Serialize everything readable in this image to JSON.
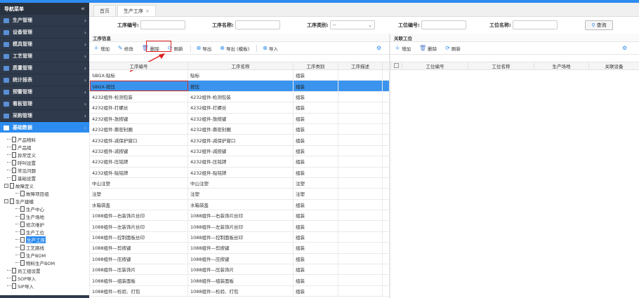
{
  "sidebar": {
    "title": "导航菜单",
    "collapse_icon": "«",
    "menu": [
      {
        "label": "生产管理",
        "icon": "gear-icon"
      },
      {
        "label": "设备管理",
        "icon": "grid-icon"
      },
      {
        "label": "模具管理",
        "icon": "table-icon"
      },
      {
        "label": "工艺管理",
        "icon": "heart-icon"
      },
      {
        "label": "质量管理",
        "icon": "circle-icon"
      },
      {
        "label": "统计报表",
        "icon": "chart-icon"
      },
      {
        "label": "预警管理",
        "icon": "chart-icon"
      },
      {
        "label": "看板管理",
        "icon": "screen-icon"
      },
      {
        "label": "采购管理",
        "icon": "cart-icon"
      },
      {
        "label": "基础数据",
        "icon": "gear-icon"
      }
    ],
    "tree": [
      {
        "label": "产品物料",
        "level": 1
      },
      {
        "label": "产品组",
        "level": 1
      },
      {
        "label": "异常定义",
        "level": 1
      },
      {
        "label": "呼叫设置",
        "level": 1
      },
      {
        "label": "常见问题",
        "level": 1
      },
      {
        "label": "基础设置",
        "level": 1
      },
      {
        "label": "故障定义",
        "level": 0,
        "toggle": "-"
      },
      {
        "label": "故障项目组",
        "level": 2
      },
      {
        "label": "生产建模",
        "level": 0,
        "toggle": "-"
      },
      {
        "label": "生产中心",
        "level": 2
      },
      {
        "label": "生产场地",
        "level": 2
      },
      {
        "label": "班次维护",
        "level": 2
      },
      {
        "label": "生产工位",
        "level": 2
      },
      {
        "label": "生产工序",
        "level": 2,
        "selected": true
      },
      {
        "label": "工艺路线",
        "level": 2
      },
      {
        "label": "生产BOM",
        "level": 2
      },
      {
        "label": "物料生产BOM",
        "level": 2
      },
      {
        "label": "员工组设置",
        "level": 1
      },
      {
        "label": "SOP导入",
        "level": 1
      },
      {
        "label": "SIP导入",
        "level": 1
      }
    ]
  },
  "tabs": [
    {
      "label": "首页"
    },
    {
      "label": "生产工序",
      "close": "×"
    }
  ],
  "search": {
    "process_code_label": "工序编号:",
    "process_name_label": "工序名称:",
    "process_type_label": "工序类别:",
    "process_type_value": "--",
    "station_code_label": "工位编号:",
    "station_name_label": "工位名称:",
    "query_label": "查询"
  },
  "left_panel": {
    "title": "工序信息",
    "toolbar": {
      "add": "增加",
      "edit": "修改",
      "delete": "删除",
      "refresh": "刷新",
      "export": "导出",
      "export_template": "导出 (模板)",
      "import": "导入"
    },
    "columns": [
      "工序编号",
      "工序名称",
      "工序类别",
      "工序描述"
    ],
    "rows": [
      [
        "SBGX-贴标",
        "贴标",
        "组装",
        ""
      ],
      [
        "SBGX-按压",
        "按压",
        "组装",
        ""
      ],
      [
        "4232组件-检测包装",
        "4232组件-检测包装",
        "组装",
        ""
      ],
      [
        "4232组件-打螺丝",
        "4232组件-打螺丝",
        "组装",
        ""
      ],
      [
        "4232组件-放按键",
        "4232组件-放按键",
        "组装",
        ""
      ],
      [
        "4232组件-撕密封圈",
        "4232组件-撕密封圈",
        "组装",
        ""
      ],
      [
        "4232组件-减保护窗口",
        "4232组件-减保护窗口",
        "组装",
        ""
      ],
      [
        "4232组件-减按键",
        "4232组件-减按键",
        "组装",
        ""
      ],
      [
        "4232组件-压铭牌",
        "4232组件-压铭牌",
        "组装",
        ""
      ],
      [
        "4232组件-贴铭牌",
        "4232组件-贴铭牌",
        "组装",
        ""
      ],
      [
        "中山注塑",
        "中山注塑",
        "注塑",
        ""
      ],
      [
        "注塑",
        "注塑",
        "注塑",
        ""
      ],
      [
        "水箱袋盖",
        "水箱袋盖",
        "组装",
        ""
      ],
      [
        "1088组件—右装饰片丝印",
        "1088组件—右装饰片丝印",
        "组装",
        ""
      ],
      [
        "1088组件—左装饰片丝印",
        "1088组件—左装饰片丝印",
        "组装",
        ""
      ],
      [
        "1088组件—控制面板丝印",
        "1088组件—控制面板丝印",
        "组装",
        ""
      ],
      [
        "1088组件—剪按键",
        "1088组件—剪按键",
        "组装",
        ""
      ],
      [
        "1088组件—压按键",
        "1088组件—压按键",
        "组装",
        ""
      ],
      [
        "1088组件—压装饰片",
        "1088组件—压装饰片",
        "组装",
        ""
      ],
      [
        "1088组件—组装面板",
        "1088组件—组装面板",
        "组装",
        ""
      ],
      [
        "1088组件—检验、打包",
        "1088组件—检验、打包",
        "组装",
        ""
      ]
    ],
    "selected_row": 1
  },
  "right_panel": {
    "title": "关联工位",
    "toolbar": {
      "add": "增加",
      "delete": "删除",
      "refresh": "刷新"
    },
    "columns": [
      "",
      "工位编号",
      "工位名称",
      "生产场地",
      "关联设备"
    ]
  },
  "colors": {
    "accent": "#2d8cf0",
    "sidebar": "#2f3b4c",
    "highlight": "#e02020"
  }
}
